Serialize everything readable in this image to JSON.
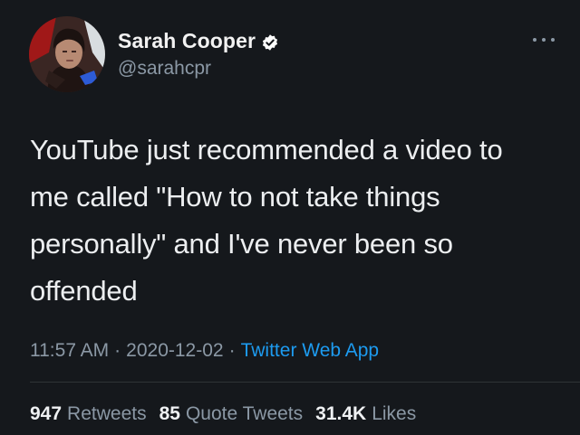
{
  "user": {
    "display_name": "Sarah Cooper",
    "handle": "@sarahcpr",
    "verified": true
  },
  "tweet": {
    "text": "YouTube just recommended a video to\nme called \"How to not take things\npersonally\" and I've never been so\noffended",
    "time": "11:57 AM",
    "separator": "·",
    "date": "2020-12-02",
    "source": "Twitter Web App"
  },
  "stats": {
    "retweets": {
      "count": "947",
      "label": "Retweets"
    },
    "quote_tweets": {
      "count": "85",
      "label": "Quote Tweets"
    },
    "likes": {
      "count": "31.4K",
      "label": "Likes"
    }
  },
  "colors": {
    "background": "#15181c",
    "accent": "#1d9bf0",
    "secondary_text": "#8b98a5"
  },
  "icons": {
    "verified": "verified-badge-icon",
    "more": "more-options-icon"
  }
}
